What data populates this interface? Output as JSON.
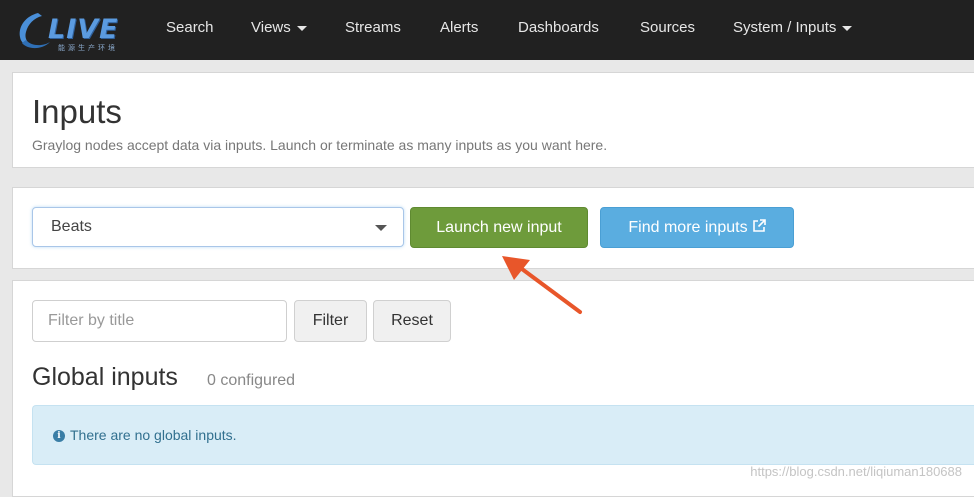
{
  "logo": {
    "text": "LIVE",
    "subtitle": "能源生产环境"
  },
  "nav": {
    "items": [
      {
        "label": "Search",
        "dropdown": false
      },
      {
        "label": "Views",
        "dropdown": true
      },
      {
        "label": "Streams",
        "dropdown": false
      },
      {
        "label": "Alerts",
        "dropdown": false
      },
      {
        "label": "Dashboards",
        "dropdown": false
      },
      {
        "label": "Sources",
        "dropdown": false
      },
      {
        "label": "System / Inputs",
        "dropdown": true
      }
    ]
  },
  "header": {
    "title": "Inputs",
    "description": "Graylog nodes accept data via inputs. Launch or terminate as many inputs as you want here."
  },
  "launcher": {
    "selected_input": "Beats",
    "launch_label": "Launch new input",
    "find_more_label": "Find more inputs"
  },
  "filter": {
    "placeholder": "Filter by title",
    "filter_label": "Filter",
    "reset_label": "Reset"
  },
  "global_inputs": {
    "title": "Global inputs",
    "count_text": "0 configured",
    "empty_message": "There are no global inputs."
  },
  "annotation": {
    "arrow_color": "#e8562a"
  },
  "colors": {
    "navbar_bg": "#212121",
    "launch_button": "#6e9b3b",
    "find_button": "#5aade0",
    "info_alert_bg": "#d9edf7"
  },
  "watermark": "https://blog.csdn.net/liqiuman180688"
}
